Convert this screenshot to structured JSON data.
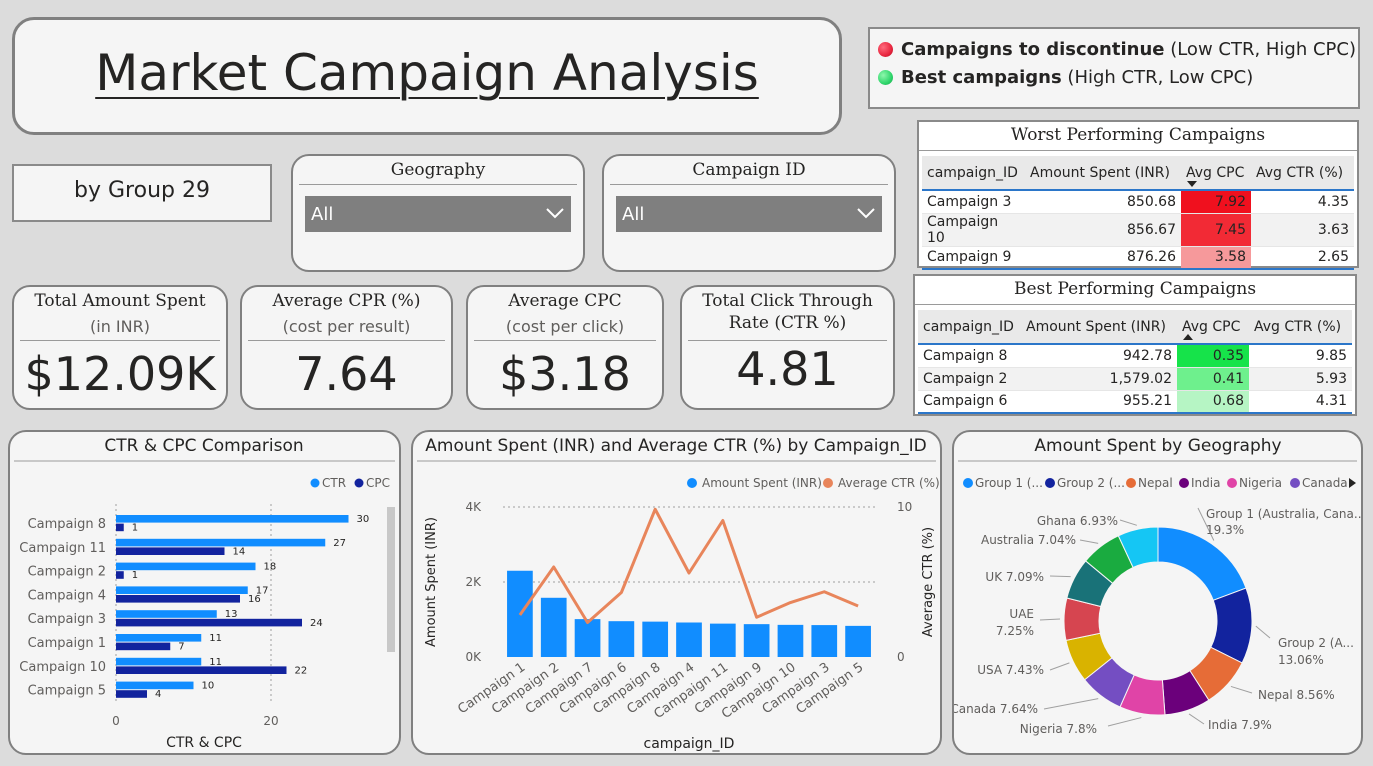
{
  "title": "Market Campaign Analysis",
  "subtitle": "by Group 29",
  "legend": {
    "discontinue": {
      "bold": "Campaigns to discontinue",
      "rest": " (Low CTR, High CPC)",
      "color": "#e8263f"
    },
    "best": {
      "bold": "Best campaigns",
      "rest": " (High CTR, Low CPC)",
      "color": "#2fd56b"
    }
  },
  "slicers": {
    "geography": {
      "label": "Geography",
      "value": "All"
    },
    "campaign": {
      "label": "Campaign ID",
      "value": "All"
    }
  },
  "kpis": {
    "spent": {
      "title": "Total Amount Spent",
      "sub": "(in INR)",
      "value": "$12.09K"
    },
    "cpr": {
      "title": "Average CPR (%)",
      "sub": "(cost per result)",
      "value": "7.64"
    },
    "cpc": {
      "title": "Average CPC",
      "sub": "(cost per click)",
      "value": "$3.18"
    },
    "ctr": {
      "title1": "Total Click Through",
      "title2": "Rate (CTR %)",
      "value": "4.81"
    }
  },
  "tables": {
    "headers": [
      "campaign_ID",
      "Amount Spent (INR)",
      "Avg CPC",
      "Avg CTR (%)"
    ],
    "worst": {
      "title": "Worst Performing Campaigns",
      "rows": [
        {
          "id": "Campaign 3",
          "spent": "850.68",
          "cpc": "7.92",
          "ctr": "4.35",
          "color": "#f0101e"
        },
        {
          "id": "Campaign 10",
          "spent": "856.67",
          "cpc": "7.45",
          "ctr": "3.63",
          "color": "#f22a35"
        },
        {
          "id": "Campaign 9",
          "spent": "876.26",
          "cpc": "3.58",
          "ctr": "2.65",
          "color": "#f6999b"
        }
      ]
    },
    "best": {
      "title": "Best Performing Campaigns",
      "rows": [
        {
          "id": "Campaign 8",
          "spent": "942.78",
          "cpc": "0.35",
          "ctr": "9.85",
          "color": "#16e34a"
        },
        {
          "id": "Campaign 2",
          "spent": "1,579.02",
          "cpc": "0.41",
          "ctr": "5.93",
          "color": "#6ef08d"
        },
        {
          "id": "Campaign 6",
          "spent": "955.21",
          "cpc": "0.68",
          "ctr": "4.31",
          "color": "#b6f5c4"
        }
      ]
    }
  },
  "chart_data": [
    {
      "type": "bar",
      "orientation": "horizontal",
      "title": "CTR & CPC Comparison",
      "xlabel": "CTR & CPC",
      "ylabel": "",
      "categories": [
        "Campaign 8",
        "Campaign 11",
        "Campaign 2",
        "Campaign 4",
        "Campaign 3",
        "Campaign 1",
        "Campaign 10",
        "Campaign 5"
      ],
      "series": [
        {
          "name": "CTR",
          "color": "#118dff",
          "values": [
            30,
            27,
            18,
            17,
            13,
            11,
            11,
            10
          ]
        },
        {
          "name": "CPC",
          "color": "#12239e",
          "values": [
            1,
            14,
            1,
            16,
            24,
            7,
            22,
            4
          ]
        }
      ],
      "xticks": [
        0,
        20
      ],
      "xlim": [
        0,
        40
      ],
      "grid": true,
      "legend": "top-right"
    },
    {
      "type": "bar+line",
      "title": "Amount Spent (INR) and Average CTR (%) by Campaign_ID",
      "xlabel": "campaign_ID",
      "ylabel": "Amount Spent (INR)",
      "y2label": "Average CTR (%)",
      "categories": [
        "Campaign 1",
        "Campaign 2",
        "Campaign 7",
        "Campaign 6",
        "Campaign 8",
        "Campaign 4",
        "Campaign 11",
        "Campaign 9",
        "Campaign 10",
        "Campaign 3",
        "Campaign 5"
      ],
      "series": [
        {
          "name": "Amount Spent (INR)",
          "type": "bar",
          "axis": "left",
          "color": "#118dff",
          "values": [
            2300,
            1579,
            1010,
            955,
            943,
            920,
            890,
            876,
            857,
            851,
            830
          ]
        },
        {
          "name": "Average CTR (%)",
          "type": "line",
          "axis": "right",
          "color": "#e8855b",
          "values": [
            2.8,
            6.0,
            2.3,
            4.3,
            9.85,
            5.6,
            9.1,
            2.65,
            3.63,
            4.35,
            3.4
          ]
        }
      ],
      "ylim": [
        0,
        4000
      ],
      "y2lim": [
        0,
        10
      ],
      "yticks": [
        "0K",
        "2K",
        "4K"
      ],
      "y2ticks": [
        "0",
        "10"
      ],
      "grid": true,
      "legend": "top-right"
    },
    {
      "type": "pie",
      "variant": "donut",
      "title": "Amount Spent by Geography",
      "legend_entries": [
        "Group 1 (...",
        "Group 2 (...",
        "Nepal",
        "India",
        "Nigeria",
        "Canada"
      ],
      "slices": [
        {
          "label": "Group 1 (Australia, Cana...",
          "value": 19.3,
          "text": "19.3%",
          "color": "#118dff"
        },
        {
          "label": "Group 2 (A...",
          "value": 13.06,
          "text": "13.06%",
          "color": "#12239e"
        },
        {
          "label": "Nepal",
          "value": 8.56,
          "text": "Nepal 8.56%",
          "color": "#e66c37"
        },
        {
          "label": "India",
          "value": 7.9,
          "text": "India 7.9%",
          "color": "#6b007b"
        },
        {
          "label": "Nigeria",
          "value": 7.8,
          "text": "Nigeria 7.8%",
          "color": "#e044a7"
        },
        {
          "label": "Canada",
          "value": 7.64,
          "text": "Canada 7.64%",
          "color": "#744ec2"
        },
        {
          "label": "USA",
          "value": 7.43,
          "text": "USA 7.43%",
          "color": "#d9b300"
        },
        {
          "label": "UAE",
          "value": 7.25,
          "text": "7.25%",
          "color": "#d64550"
        },
        {
          "label": "UK",
          "value": 7.09,
          "text": "UK 7.09%",
          "color": "#197278"
        },
        {
          "label": "Australia",
          "value": 7.04,
          "text": "Australia 7.04%",
          "color": "#1aab40"
        },
        {
          "label": "Ghana",
          "value": 6.93,
          "text": "Ghana 6.93%",
          "color": "#15c6f4"
        }
      ],
      "legend": "top"
    }
  ]
}
